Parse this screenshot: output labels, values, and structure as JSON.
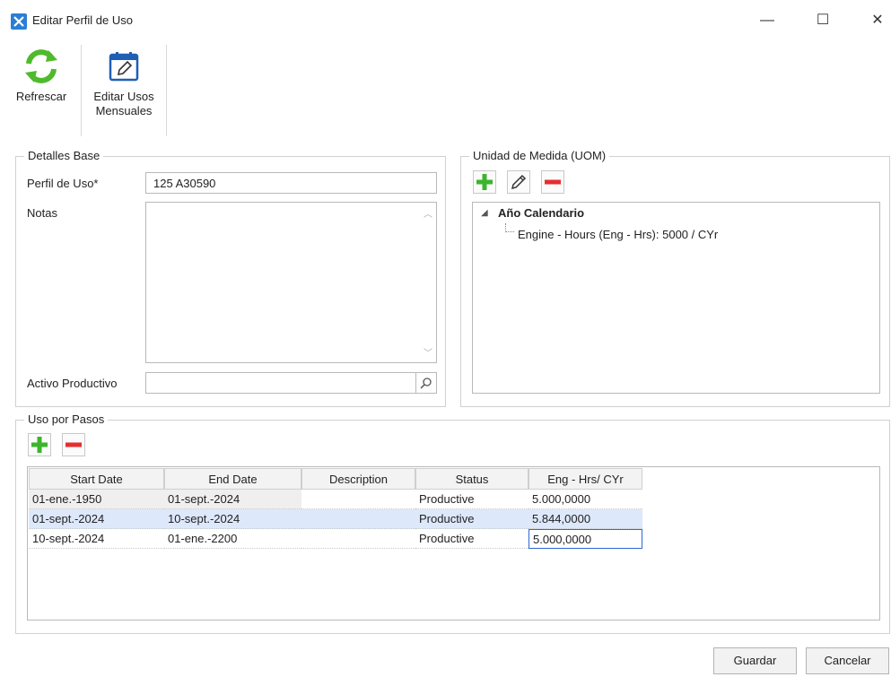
{
  "window": {
    "title": "Editar Perfil de Uso",
    "minimize": "—",
    "maximize": "☐",
    "close": "✕"
  },
  "toolbar": {
    "refresh_label": "Refrescar",
    "edit_monthly_label_1": "Editar Usos",
    "edit_monthly_label_2": "Mensuales"
  },
  "details": {
    "legend": "Detalles Base",
    "profile_label": "Perfil de Uso*",
    "profile_value": "125 A30590",
    "notes_label": "Notas",
    "asset_label": "Activo Productivo",
    "asset_value": ""
  },
  "uom": {
    "legend": "Unidad de Medida (UOM)",
    "tree": {
      "root": "Año Calendario",
      "child": "Engine - Hours (Eng - Hrs): 5000 / CYr"
    }
  },
  "steps": {
    "legend": "Uso por Pasos",
    "columns": [
      "Start Date",
      "End Date",
      "Description",
      "Status",
      "Eng - Hrs/ CYr"
    ],
    "rows": [
      [
        "01-ene.-1950",
        "01-sept.-2024",
        "",
        "Productive",
        "5.000,0000"
      ],
      [
        "01-sept.-2024",
        "10-sept.-2024",
        "",
        "Productive",
        "5.844,0000"
      ],
      [
        "10-sept.-2024",
        "01-ene.-2200",
        "",
        "Productive",
        "5.000,0000"
      ]
    ]
  },
  "footer": {
    "save_label": "Guardar",
    "cancel_label": "Cancelar"
  },
  "colors": {
    "accent": "#2b68d6",
    "add": "#3cb52d",
    "remove": "#e52e2e",
    "refresh": "#4fba2c"
  }
}
